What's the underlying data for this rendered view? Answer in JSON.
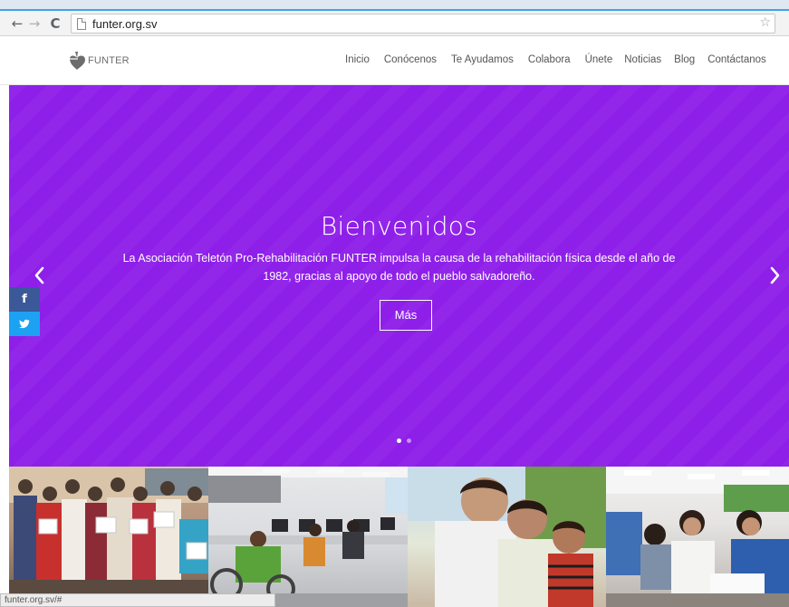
{
  "browser": {
    "url": "funter.org.sv",
    "back_glyph": "←",
    "forward_glyph": "→",
    "reload_glyph": "C",
    "star_glyph": "☆"
  },
  "header": {
    "logo_text": "FUNTER",
    "nav": [
      "Inicio",
      "Conócenos",
      "Te Ayudamos",
      "Colabora",
      "Únete",
      "Noticias",
      "Blog",
      "Contáctanos"
    ]
  },
  "hero": {
    "title": "Bienvenidos",
    "text": "La Asociación Teletón Pro-Rehabilitación FUNTER impulsa la causa de la rehabilitación física desde el año de 1982, gracias al apoyo de todo el pueblo salvadoreño.",
    "button_label": "Más",
    "slide_count": 2,
    "active_slide": 1,
    "background_color": "#8e1fe9"
  },
  "social": {
    "facebook_glyph": "f",
    "twitter_glyph": "t",
    "facebook_color": "#3b5998",
    "twitter_color": "#1da1f2"
  },
  "status_bar": {
    "text": "funter.org.sv/#"
  },
  "icons": [
    "back-arrow-icon",
    "forward-arrow-icon",
    "reload-icon",
    "page-icon",
    "star-icon",
    "funter-logo-icon",
    "chevron-left-icon",
    "chevron-right-icon",
    "facebook-icon",
    "twitter-icon"
  ]
}
